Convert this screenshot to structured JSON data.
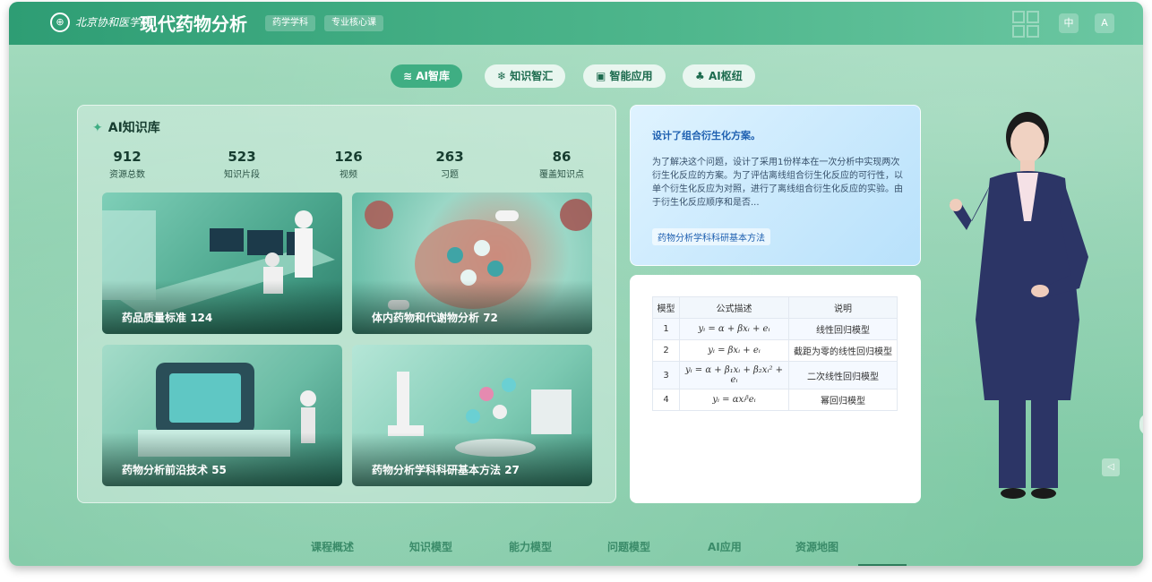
{
  "header": {
    "logo_glyph": "⊕",
    "school_name": "北京协和医学院",
    "title": "现代药物分析",
    "tags": [
      "药学学科",
      "专业核心课"
    ],
    "lang_button": "中",
    "user_icon": "A"
  },
  "nav_tabs": [
    {
      "label": "AI智库",
      "icon": "layers-icon",
      "active": true
    },
    {
      "label": "知识智汇",
      "icon": "sparkle-icon",
      "active": false
    },
    {
      "label": "智能应用",
      "icon": "ai-icon",
      "active": false
    },
    {
      "label": "AI枢纽",
      "icon": "hub-icon",
      "active": false
    }
  ],
  "kb": {
    "title": "AI知识库",
    "stats": [
      {
        "value": "912",
        "label": "资源总数"
      },
      {
        "value": "523",
        "label": "知识片段"
      },
      {
        "value": "126",
        "label": "视频"
      },
      {
        "value": "263",
        "label": "习题"
      },
      {
        "value": "86",
        "label": "覆盖知识点"
      }
    ],
    "cards": [
      {
        "label": "药品质量标准",
        "count": "124"
      },
      {
        "label": "体内药物和代谢物分析",
        "count": "72"
      },
      {
        "label": "药物分析前沿技术",
        "count": "55"
      },
      {
        "label": "药物分析学科科研基本方法",
        "count": "27"
      }
    ]
  },
  "info": {
    "title": "设计了组合衍生化方案。",
    "body": "为了解决这个问题，设计了采用1份样本在一次分析中实现两次衍生化反应的方案。为了评估离线组合衍生化反应的可行性，以单个衍生化反应为对照，进行了离线组合衍生化反应的实验。由于衍生化反应顺序和是否...",
    "link": "药物分析学科科研基本方法"
  },
  "table": {
    "headers": [
      "模型",
      "公式描述",
      "说明"
    ],
    "rows": [
      {
        "id": "1",
        "formula": "yᵢ = α + βxᵢ + eᵢ",
        "desc": "线性回归模型"
      },
      {
        "id": "2",
        "formula": "yᵢ = βxᵢ + eᵢ",
        "desc": "截距为零的线性回归模型"
      },
      {
        "id": "3",
        "formula": "yᵢ = α + β₁xᵢ + β₂xᵢ² + eᵢ",
        "desc": "二次线性回归模型"
      },
      {
        "id": "4",
        "formula": "yᵢ = αxᵢᵝeᵢ",
        "desc": "幂回归模型"
      }
    ]
  },
  "bottom_nav": [
    "课程概述",
    "知识模型",
    "能力模型",
    "问题模型",
    "AI应用",
    "资源地图"
  ],
  "colors": {
    "accent": "#3fae83",
    "header": "#2e9d74",
    "link": "#1d5fb0"
  }
}
